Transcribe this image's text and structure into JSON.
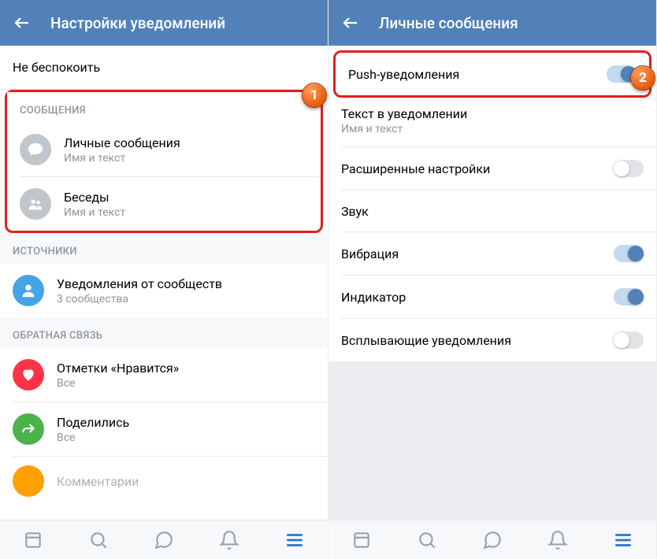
{
  "left": {
    "title": "Настройки уведомлений",
    "dnd": "Не беспокоить",
    "section_messages": "СООБЩЕНИЯ",
    "private": {
      "title": "Личные сообщения",
      "sub": "Имя и текст"
    },
    "chats": {
      "title": "Беседы",
      "sub": "Имя и текст"
    },
    "section_sources": "ИСТОЧНИКИ",
    "communities": {
      "title": "Уведомления от сообществ",
      "sub": "3 сообщества"
    },
    "section_feedback": "ОБРАТНАЯ СВЯЗЬ",
    "likes": {
      "title": "Отметки «Нравится»",
      "sub": "Все"
    },
    "shares": {
      "title": "Поделились",
      "sub": "Все"
    },
    "comments": {
      "title": "Комментарии"
    }
  },
  "right": {
    "title": "Личные сообщения",
    "push": "Push-уведомления",
    "textInNotif": {
      "title": "Текст в уведомлении",
      "sub": "Имя и текст"
    },
    "advanced": "Расширенные настройки",
    "sound": "Звук",
    "vibration": "Вибрация",
    "indicator": "Индикатор",
    "popup": "Всплывающие уведомления"
  },
  "badges": {
    "one": "1",
    "two": "2"
  }
}
